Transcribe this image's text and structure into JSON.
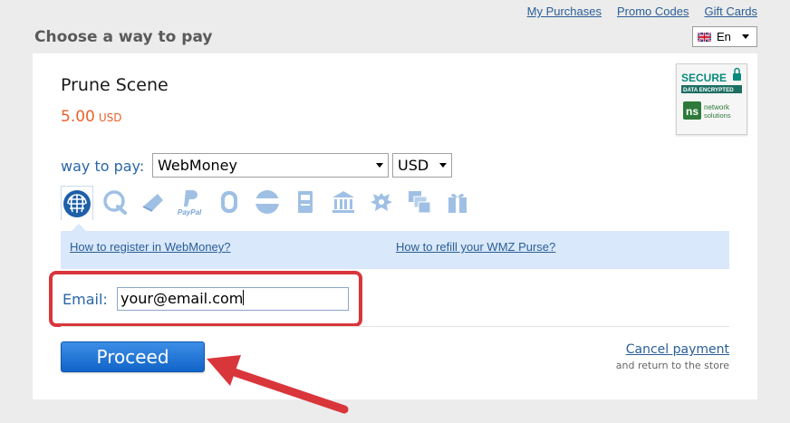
{
  "top_nav": {
    "my_purchases": "My Purchases",
    "promo_codes": "Promo Codes",
    "gift_cards": "Gift Cards"
  },
  "page_title": "Choose a way to pay",
  "language": {
    "selected": "En",
    "flag_icon": "uk-flag-icon"
  },
  "product": {
    "name": "Prune Scene",
    "price": "5.00",
    "currency": "USD"
  },
  "secure_badge": {
    "line1": "SECURE",
    "line2": "DATA ENCRYPTED",
    "line3": "network",
    "line4": "solutions",
    "logo_text": "ns"
  },
  "payment": {
    "label": "way to pay:",
    "method_selected": "WebMoney",
    "currency_selected": "USD",
    "methods": [
      {
        "name": "WebMoney",
        "icon": "webmoney-icon",
        "active": true
      },
      {
        "name": "QIWI",
        "icon": "qiwi-icon"
      },
      {
        "name": "Wallet",
        "icon": "wallet-icon"
      },
      {
        "name": "PayPal",
        "icon": "paypal-icon",
        "caption": "PayPal"
      },
      {
        "name": "Mobile",
        "icon": "mobile-icon"
      },
      {
        "name": "Bank card",
        "icon": "card-icon"
      },
      {
        "name": "Terminal",
        "icon": "terminal-icon"
      },
      {
        "name": "Bank",
        "icon": "bank-icon"
      },
      {
        "name": "Russian Post",
        "icon": "emblem-icon"
      },
      {
        "name": "Transfers",
        "icon": "transfer-icon"
      },
      {
        "name": "Gift",
        "icon": "gift-icon"
      }
    ]
  },
  "info_links": {
    "register": "How to register in WebMoney?",
    "refill": "How to refill your WMZ Purse?"
  },
  "email": {
    "label": "Email:",
    "value": "your@email.com"
  },
  "actions": {
    "proceed": "Proceed",
    "cancel": "Cancel payment",
    "cancel_sub": "and return to the store"
  },
  "colors": {
    "accent_blue": "#2a66a8",
    "price_orange": "#e8632b",
    "highlight_red": "#d9363c",
    "button_blue": "#1164c8",
    "info_strip": "#dae8fb"
  }
}
